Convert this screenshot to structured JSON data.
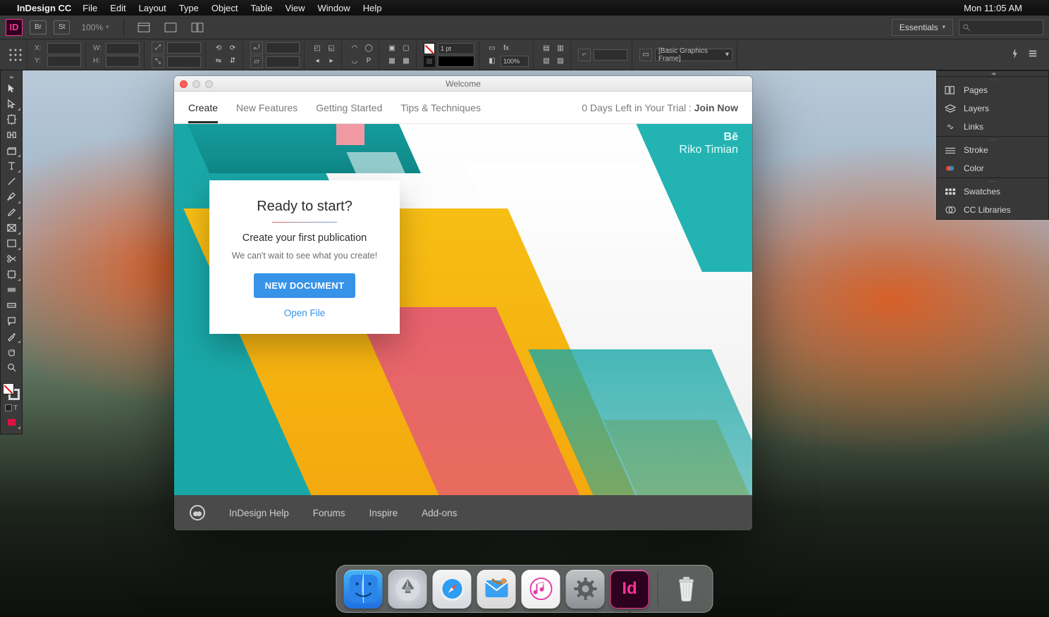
{
  "mac_menubar": {
    "app_name": "InDesign CC",
    "menus": [
      "File",
      "Edit",
      "Layout",
      "Type",
      "Object",
      "Table",
      "View",
      "Window",
      "Help"
    ],
    "clock": "Mon 11:05 AM"
  },
  "app_bar": {
    "id_badge": "ID",
    "br_chip": "Br",
    "st_chip": "St",
    "zoom": "100%",
    "workspace": "Essentials"
  },
  "control_strip": {
    "x_label": "X:",
    "x_val": "",
    "y_label": "Y:",
    "y_val": "",
    "w_label": "W:",
    "w_val": "",
    "h_label": "H:",
    "h_val": "",
    "stroke_pt": "1 pt",
    "opacity": "100%",
    "style_frame": "[Basic Graphics Frame]"
  },
  "tools": [
    "selection-tool",
    "direct-selection-tool",
    "page-tool",
    "gap-tool",
    "content-collector-tool",
    "type-tool",
    "line-tool",
    "pen-tool",
    "pencil-tool",
    "rectangle-frame-tool",
    "rectangle-tool",
    "scissors-tool",
    "free-transform-tool",
    "gradient-swatch-tool",
    "gradient-feather-tool",
    "note-tool",
    "eyedropper-tool",
    "hand-tool",
    "zoom-tool"
  ],
  "right_panels": {
    "group1": [
      "Pages",
      "Layers",
      "Links"
    ],
    "group2": [
      "Stroke",
      "Color"
    ],
    "group3": [
      "Swatches",
      "CC Libraries"
    ]
  },
  "welcome": {
    "title": "Welcome",
    "tabs": [
      "Create",
      "New Features",
      "Getting Started",
      "Tips & Techniques"
    ],
    "active_tab": 0,
    "trial_text": "0 Days Left in Your Trial : ",
    "trial_cta": "Join Now",
    "credit_source": "Bē",
    "credit_name": "Riko Timian",
    "card": {
      "heading": "Ready to start?",
      "sub": "Create your first publication",
      "body": "We can't wait to see what you create!",
      "new_btn": "NEW DOCUMENT",
      "open_link": "Open File"
    },
    "footer_links": [
      "InDesign Help",
      "Forums",
      "Inspire",
      "Add-ons"
    ]
  },
  "dock": {
    "apps": [
      {
        "name": "finder",
        "running": true
      },
      {
        "name": "launchpad",
        "running": false
      },
      {
        "name": "safari",
        "running": false
      },
      {
        "name": "mail",
        "running": false
      },
      {
        "name": "itunes",
        "running": false
      },
      {
        "name": "system-preferences",
        "running": false
      },
      {
        "name": "indesign",
        "running": true
      }
    ],
    "id_label": "Id"
  }
}
